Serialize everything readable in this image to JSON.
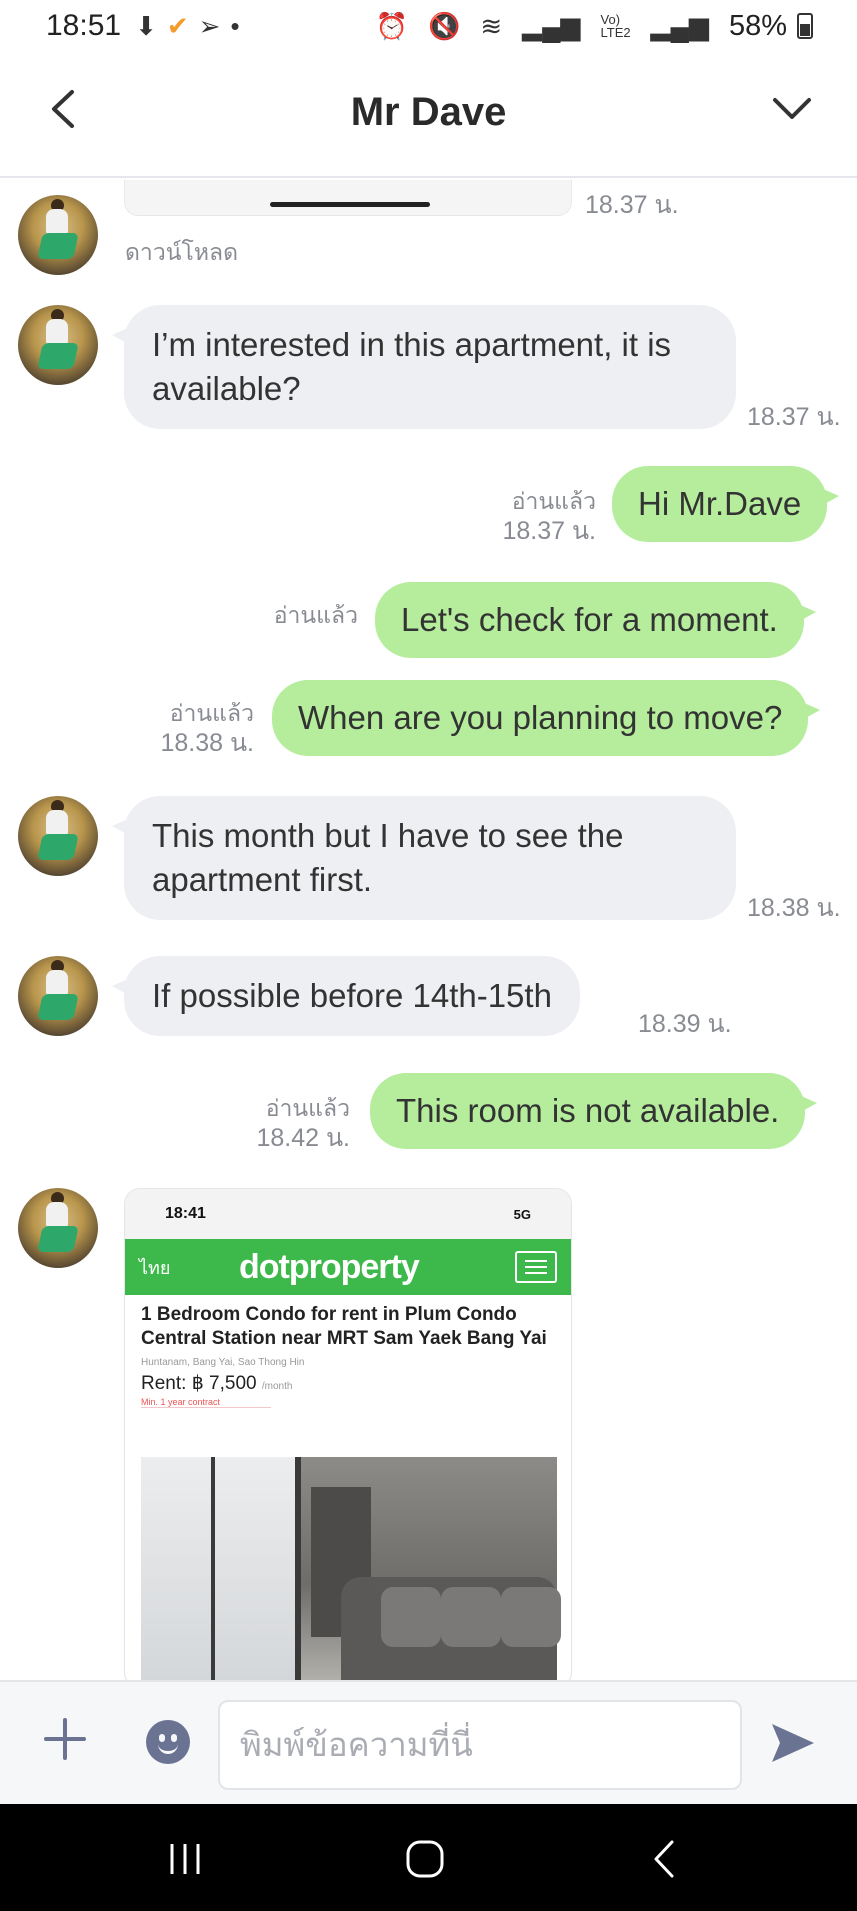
{
  "status_bar": {
    "time": "18:51",
    "battery": "58%",
    "network_label": "Vo) LTE2"
  },
  "header": {
    "title": "Mr Dave"
  },
  "messages": [
    {
      "id": "m0",
      "side": "in",
      "kind": "image-partial",
      "time": "18.37 น.",
      "caption": "ดาวน์โหลด"
    },
    {
      "id": "m1",
      "side": "in",
      "kind": "text",
      "text": "I’m interested in this apartment, it is available?",
      "time": "18.37 น."
    },
    {
      "id": "m2",
      "side": "out",
      "kind": "text",
      "text": "Hi Mr.Dave",
      "read": "อ่านแล้ว",
      "time": "18.37 น."
    },
    {
      "id": "m3",
      "side": "out",
      "kind": "text",
      "text": "Let's check for a moment.",
      "read": "อ่านแล้ว",
      "time": ""
    },
    {
      "id": "m4",
      "side": "out",
      "kind": "text",
      "text": "When are you planning to move?",
      "read": "อ่านแล้ว",
      "time": "18.38 น."
    },
    {
      "id": "m5",
      "side": "in",
      "kind": "text",
      "text": "This month but I have to see the apartment first.",
      "time": "18.38 น."
    },
    {
      "id": "m6",
      "side": "in",
      "kind": "text",
      "text": "If possible before 14th-15th",
      "time": "18.39 น."
    },
    {
      "id": "m7",
      "side": "out",
      "kind": "text",
      "text": "This room is not available.",
      "read": "อ่านแล้ว",
      "time": "18.42 น."
    }
  ],
  "image_message": {
    "status_time": "18:41",
    "signal": "5G",
    "lang": "ไทย",
    "brand": "dotproperty",
    "listing_title": "1 Bedroom Condo for rent in Plum Condo Central Station near MRT Sam Yaek Bang Yai",
    "location": "Huntanam, Bang Yai, Sao Thong Hin",
    "rent": "Rent: ฿ 7,500",
    "rent_unit": "/month",
    "note": "Min. 1 year contract"
  },
  "input": {
    "placeholder": "พิมพ์ข้อความที่นี่"
  },
  "icons": {
    "back": "chevron-left-icon",
    "menu": "chevron-down-icon",
    "add": "plus-icon",
    "emoji": "emoji-icon",
    "send": "send-icon"
  },
  "colors": {
    "incoming_bubble": "#eeeff2",
    "outgoing_bubble": "#b5ed9d",
    "meta_text": "#888b92",
    "brand_green": "#3cb94a"
  }
}
